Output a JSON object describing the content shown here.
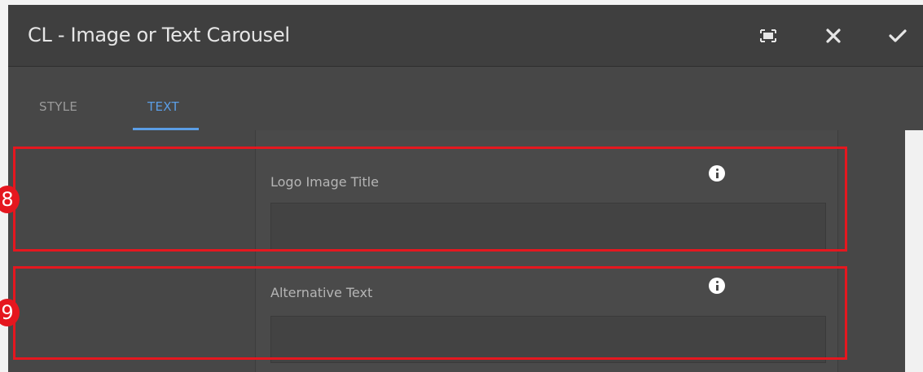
{
  "dialog": {
    "title": "CL - Image or Text Carousel",
    "actions": {
      "fullscreen_icon": "fullscreen-icon",
      "close_icon": "close-icon",
      "confirm_icon": "check-icon"
    },
    "tabs": [
      {
        "label": "STYLE",
        "selected": false
      },
      {
        "label": "TEXT",
        "selected": true
      }
    ]
  },
  "fields": [
    {
      "label": "Logo Image Title",
      "value": "",
      "info_icon": "info-icon"
    },
    {
      "label": "Alternative Text",
      "value": "",
      "info_icon": "info-icon"
    }
  ],
  "annotations": [
    {
      "number": "8"
    },
    {
      "number": "9"
    }
  ],
  "colors": {
    "accent": "#5b9ee6",
    "highlight": "#e5171f",
    "background": "#474747"
  }
}
